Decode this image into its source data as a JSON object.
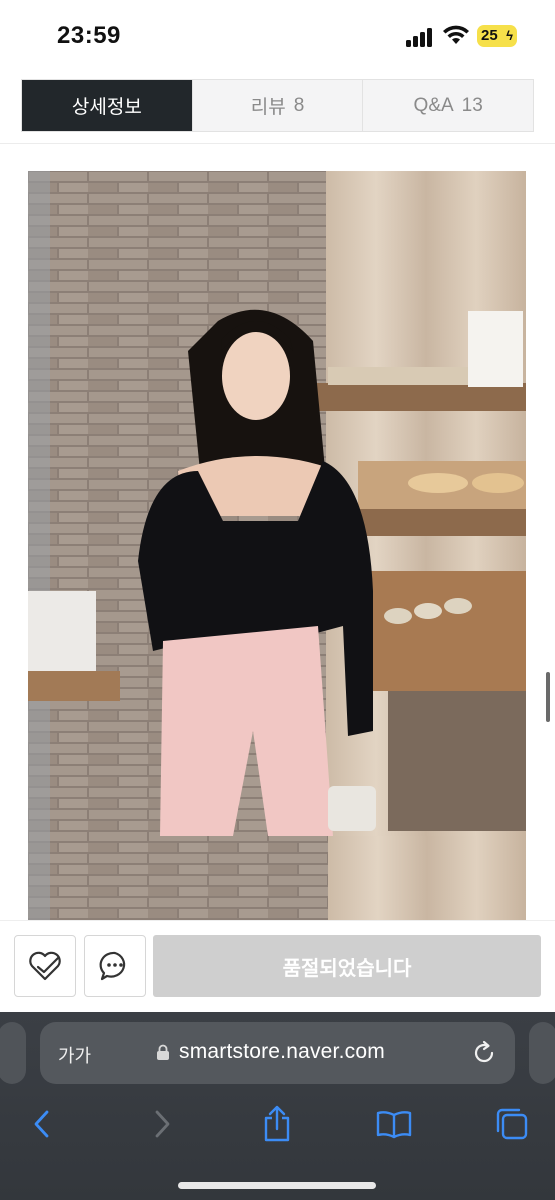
{
  "status_bar": {
    "time": "23:59",
    "battery_level": "25",
    "icons": [
      "signal-icon",
      "wifi-icon",
      "battery-icon"
    ]
  },
  "tabs": [
    {
      "label": "상세정보",
      "count": "",
      "active": true
    },
    {
      "label": "리뷰",
      "count": "8",
      "active": false
    },
    {
      "label": "Q&A",
      "count": "13",
      "active": false
    }
  ],
  "action_bar": {
    "wishlist_icon": "heart-check-icon",
    "chat_icon": "chat-bubble-icon",
    "soldout_label": "품절되었습니다"
  },
  "browser": {
    "text_size_label": "가가",
    "url": "smartstore.naver.com",
    "toolbar_icons": [
      "back-icon",
      "forward-icon",
      "share-icon",
      "bookmarks-icon",
      "tabs-icon"
    ]
  },
  "colors": {
    "tab_active_bg": "#22272b",
    "soldout_bg": "#cfcfcf",
    "browser_bg": "#3b3f45",
    "accent_blue": "#3c8cf5"
  }
}
